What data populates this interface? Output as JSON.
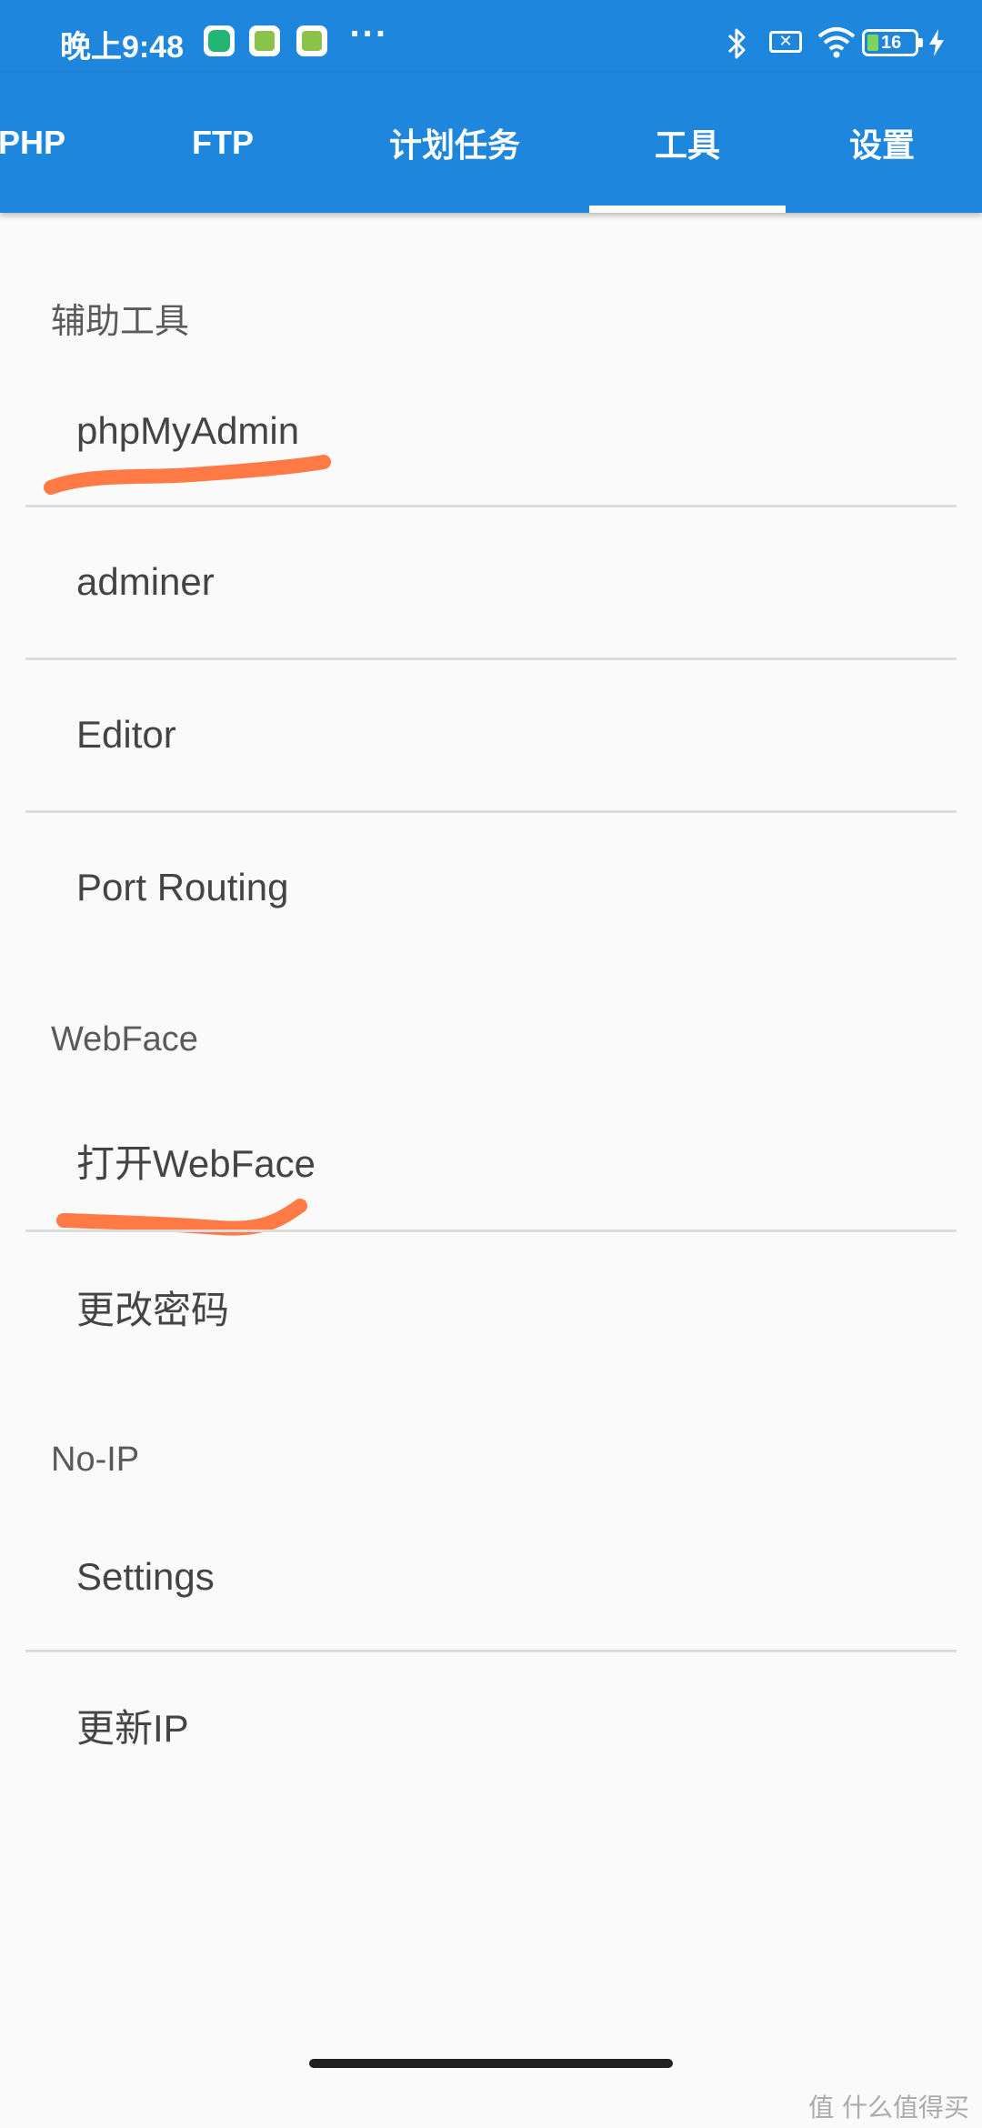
{
  "status_bar": {
    "time": "晚上9:48",
    "battery": "16",
    "sim": "✕",
    "more": "···"
  },
  "tabs": [
    {
      "label": "PHP"
    },
    {
      "label": "FTP"
    },
    {
      "label": "计划任务"
    },
    {
      "label": "工具",
      "active": true
    },
    {
      "label": "设置"
    }
  ],
  "sections": [
    {
      "header": "辅助工具",
      "items": [
        "phpMyAdmin",
        "adminer",
        "Editor",
        "Port Routing"
      ]
    },
    {
      "header": "WebFace",
      "items": [
        "打开WebFace",
        "更改密码"
      ]
    },
    {
      "header": "No-IP",
      "items": [
        "Settings",
        "更新IP"
      ]
    }
  ],
  "colors": {
    "primary": "#1f86dd",
    "highlight_marker": "#ff7a45"
  },
  "watermark": "值 什么值得买"
}
